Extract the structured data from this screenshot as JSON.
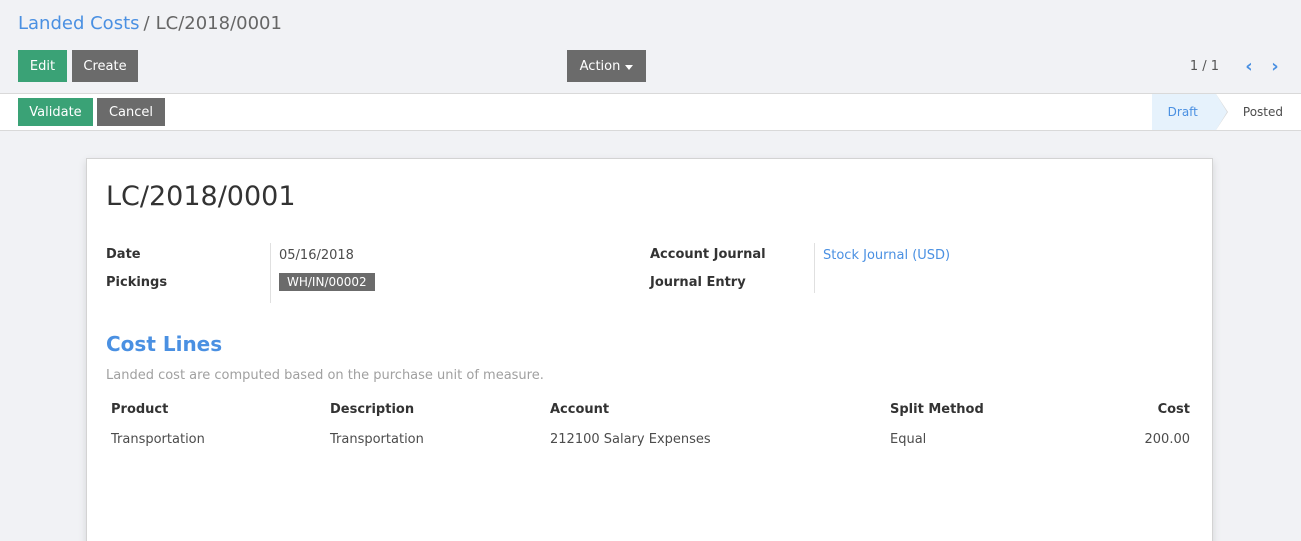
{
  "breadcrumb": {
    "parent": "Landed Costs",
    "separator": "/",
    "current": "LC/2018/0001"
  },
  "toolbar": {
    "edit_label": "Edit",
    "create_label": "Create",
    "action_label": "Action"
  },
  "pager": {
    "value": "1 / 1",
    "prev_icon": "chevron-left-icon",
    "next_icon": "chevron-right-icon"
  },
  "statusbar": {
    "validate_label": "Validate",
    "cancel_label": "Cancel",
    "stages": [
      {
        "label": "Draft",
        "active": true
      },
      {
        "label": "Posted",
        "active": false
      }
    ]
  },
  "form": {
    "title": "LC/2018/0001",
    "date_label": "Date",
    "date_value": "05/16/2018",
    "pickings_label": "Pickings",
    "pickings_value": "WH/IN/00002",
    "account_journal_label": "Account Journal",
    "account_journal_value": "Stock Journal (USD)",
    "journal_entry_label": "Journal Entry",
    "journal_entry_value": ""
  },
  "cost_lines": {
    "title": "Cost Lines",
    "help": "Landed cost are computed based on the purchase unit of measure.",
    "columns": [
      "Product",
      "Description",
      "Account",
      "Split Method",
      "Cost"
    ],
    "rows": [
      [
        "Transportation",
        "Transportation",
        "212100 Salary Expenses",
        "Equal",
        "200.00"
      ]
    ]
  },
  "colors": {
    "primary": "#3aa276",
    "secondary": "#6b6b6b",
    "link": "#4a90e2"
  }
}
